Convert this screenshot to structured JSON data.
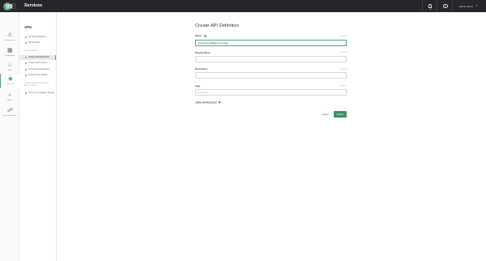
{
  "app": {
    "title": "Services",
    "logo": "gg"
  },
  "user": {
    "name": "admin admin"
  },
  "leftnav": [
    {
      "label": "Infrastructure",
      "icon": "warning-icon"
    },
    {
      "label": "Dashboards",
      "icon": "grid-icon"
    },
    {
      "label": "Tools",
      "icon": "toolbox-icon"
    },
    {
      "label": "Services",
      "icon": "diamond-icon"
    },
    {
      "label": "Alerts",
      "icon": "lightbulb-icon"
    },
    {
      "label": "Access Control",
      "icon": "users-icon"
    }
  ],
  "sidebar": {
    "title": "APIs",
    "items_top": [
      "All API Definitions",
      "API Portals"
    ],
    "section_define": "DEFINE AN API",
    "items_define": [
      "Create API Definition",
      "Create API Version",
      "Create Presidential A",
      "Create Data Model"
    ],
    "section_external": "CREATE AN EXTERNAL API AND CONNECT",
    "items_external": [
      "Connect to Apigee Tenant"
    ]
  },
  "form": {
    "title": "Create API Definition",
    "name_label": "Name *",
    "name_hint": "Required",
    "name_value": "/mumbaistrvallfibamericore/api",
    "display_label": "Display Name",
    "display_hint": "Optional",
    "desc_label": "Description",
    "desc_hint": "Optional",
    "tags_label": "Tags",
    "tags_hint": "Optional",
    "tags_placeholder": "Enter tags",
    "view_request": "VIEW API REQUEST",
    "cancel": "Cancel",
    "submit": "Submit"
  },
  "colors": {
    "accent": "#58a37c",
    "topbar": "#26272b",
    "submit": "#3f8d64"
  }
}
